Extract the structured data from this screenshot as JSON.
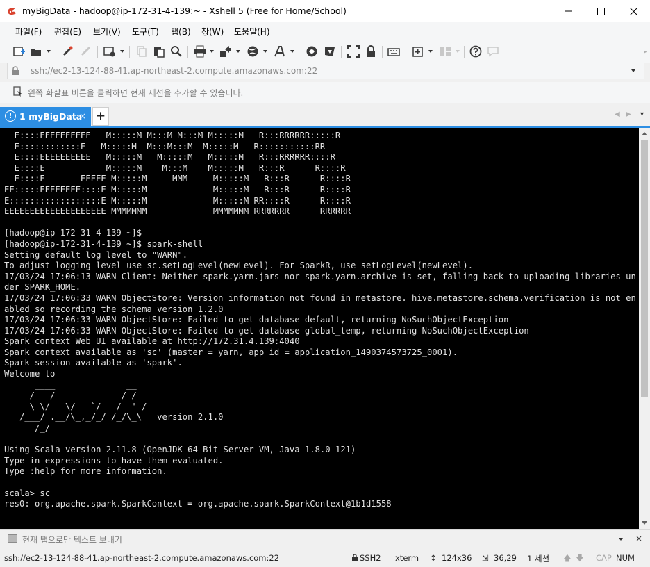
{
  "window": {
    "title": "myBigData - hadoop@ip-172-31-4-139:~ - Xshell 5 (Free for Home/School)"
  },
  "menu": {
    "items": [
      "파일(F)",
      "편집(E)",
      "보기(V)",
      "도구(T)",
      "탭(B)",
      "창(W)",
      "도움말(H)"
    ]
  },
  "address": {
    "value": "ssh://ec2-13-124-88-41.ap-northeast-2.compute.amazonaws.com:22"
  },
  "hint": {
    "text": "왼쪽 화살표 버튼을 클릭하면 현재 세션을 추가할 수 있습니다."
  },
  "tabs": {
    "active": {
      "number": "1",
      "label": "myBigData",
      "close": "×"
    },
    "add": "+"
  },
  "terminal": {
    "lines": [
      "  E::::EEEEEEEEEE   M:::::M M:::M M:::M M:::::M   R:::RRRRRR:::::R",
      "  E::::::::::::E   M:::::M  M:::M:::M  M:::::M   R:::::::::::RR",
      "  E::::EEEEEEEEEE   M:::::M   M:::::M   M:::::M   R:::RRRRRR::::R",
      "  E::::E            M:::::M    M:::M    M:::::M   R:::R      R::::R",
      "  E::::E       EEEEE M:::::M     MMM     M:::::M   R:::R      R::::R",
      "EE:::::EEEEEEEE::::E M:::::M             M:::::M   R:::R      R::::R",
      "E::::::::::::::::::E M:::::M             M:::::M RR::::R      R::::R",
      "EEEEEEEEEEEEEEEEEEEE MMMMMMM             MMMMMMM RRRRRRR      RRRRRR",
      "",
      "[hadoop@ip-172-31-4-139 ~]$",
      "[hadoop@ip-172-31-4-139 ~]$ spark-shell",
      "Setting default log level to \"WARN\".",
      "To adjust logging level use sc.setLogLevel(newLevel). For SparkR, use setLogLevel(newLevel).",
      "17/03/24 17:06:13 WARN Client: Neither spark.yarn.jars nor spark.yarn.archive is set, falling back to uploading libraries un",
      "der SPARK_HOME.",
      "17/03/24 17:06:33 WARN ObjectStore: Version information not found in metastore. hive.metastore.schema.verification is not en",
      "abled so recording the schema version 1.2.0",
      "17/03/24 17:06:33 WARN ObjectStore: Failed to get database default, returning NoSuchObjectException",
      "17/03/24 17:06:33 WARN ObjectStore: Failed to get database global_temp, returning NoSuchObjectException",
      "Spark context Web UI available at http://172.31.4.139:4040",
      "Spark context available as 'sc' (master = yarn, app id = application_1490374573725_0001).",
      "Spark session available as 'spark'.",
      "Welcome to",
      "      ____              __",
      "     / __/__  ___ _____/ /__",
      "    _\\ \\/ _ \\/ _ `/ __/  '_/",
      "   /___/ .__/\\_,_/_/ /_/\\_\\   version 2.1.0",
      "      /_/",
      "",
      "Using Scala version 2.11.8 (OpenJDK 64-Bit Server VM, Java 1.8.0_121)",
      "Type in expressions to have them evaluated.",
      "Type :help for more information.",
      "",
      "scala> sc",
      "res0: org.apache.spark.SparkContext = org.apache.spark.SparkContext@1b1d1558"
    ]
  },
  "compose": {
    "text": "현재 탭으로만 텍스트 보내기",
    "close": "×"
  },
  "status": {
    "address": "ssh://ec2-13-124-88-41.ap-northeast-2.compute.amazonaws.com:22",
    "protocol": "SSH2",
    "term": "xterm",
    "size": "124x36",
    "cursor": "36,29",
    "sessions": "1 세션",
    "caps": "CAP",
    "num": "NUM"
  }
}
